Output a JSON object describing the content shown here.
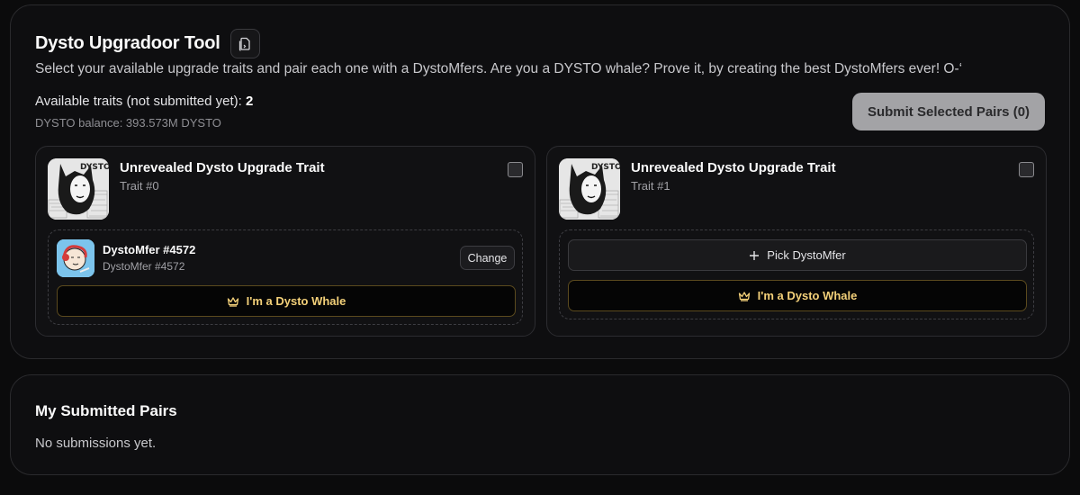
{
  "header": {
    "title": "Dysto Upgradoor Tool",
    "copy_icon": "copy-page-icon",
    "subtitle": "Select your available upgrade traits and pair each one with a DystoMfers. Are you a DYSTO whale? Prove it, by creating the best DystoMfers ever! O-‘"
  },
  "summary": {
    "traits_label": "Available traits (not submitted yet):",
    "traits_count": "2",
    "balance": "DYSTO balance: 393.573M DYSTO",
    "submit_label": "Submit Selected Pairs (0)"
  },
  "traits": [
    {
      "name": "Unrevealed Dysto Upgrade Trait",
      "id": "Trait #0",
      "checked": false,
      "mfer": {
        "name": "DystoMfer #4572",
        "sub": "DystoMfer #4572",
        "change_label": "Change"
      },
      "whale_label": "I'm a Dysto Whale"
    },
    {
      "name": "Unrevealed Dysto Upgrade Trait",
      "id": "Trait #1",
      "checked": false,
      "pick_label": "Pick DystoMfer",
      "whale_label": "I'm a Dysto Whale"
    }
  ],
  "submitted": {
    "title": "My Submitted Pairs",
    "empty": "No submissions yet."
  },
  "colors": {
    "background": "#0b0b0c",
    "accent_gold": "#f3d079",
    "submit_bg": "#a3a3a6"
  }
}
